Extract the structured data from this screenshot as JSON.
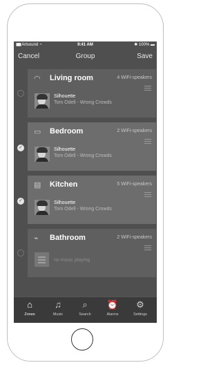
{
  "status": {
    "carrier": "Artsound",
    "time": "9:41 AM",
    "battery": "100%"
  },
  "nav": {
    "cancel_label": "Cancel",
    "title": "Group",
    "save_label": "Save"
  },
  "zones": [
    {
      "name": "Living room",
      "speakers": "4 WiFi-speakers",
      "selected": false,
      "icon": "headphones-icon",
      "track": "Silhouette",
      "artist": "Tom Odell - Wrong Crowds"
    },
    {
      "name": "Bedroom",
      "speakers": "2 WiFi-speakers",
      "selected": true,
      "icon": "bed-icon",
      "track": "Silhouette",
      "artist": "Tom Odell - Wrong Crowds"
    },
    {
      "name": "Kitchen",
      "speakers": "5 WiFi-speakers",
      "selected": true,
      "icon": "oven-icon",
      "track": "Silhouette",
      "artist": "Tom Odell - Wrong Crowds"
    },
    {
      "name": "Bathroom",
      "speakers": "2 WiFi-speakers",
      "selected": false,
      "icon": "shower-icon",
      "status": "no music playing"
    }
  ],
  "tabs": [
    {
      "label": "Zones",
      "icon": "home-icon",
      "active": true
    },
    {
      "label": "Music",
      "icon": "music-note-icon",
      "active": false
    },
    {
      "label": "Search",
      "icon": "search-icon",
      "active": false
    },
    {
      "label": "Alarms",
      "icon": "alarm-clock-icon",
      "active": false
    },
    {
      "label": "Settings",
      "icon": "gear-icon",
      "active": false
    }
  ],
  "colors": {
    "background": "#4f4f4f",
    "card": "#6d6d6d",
    "tabbar": "#3a3a3a"
  }
}
